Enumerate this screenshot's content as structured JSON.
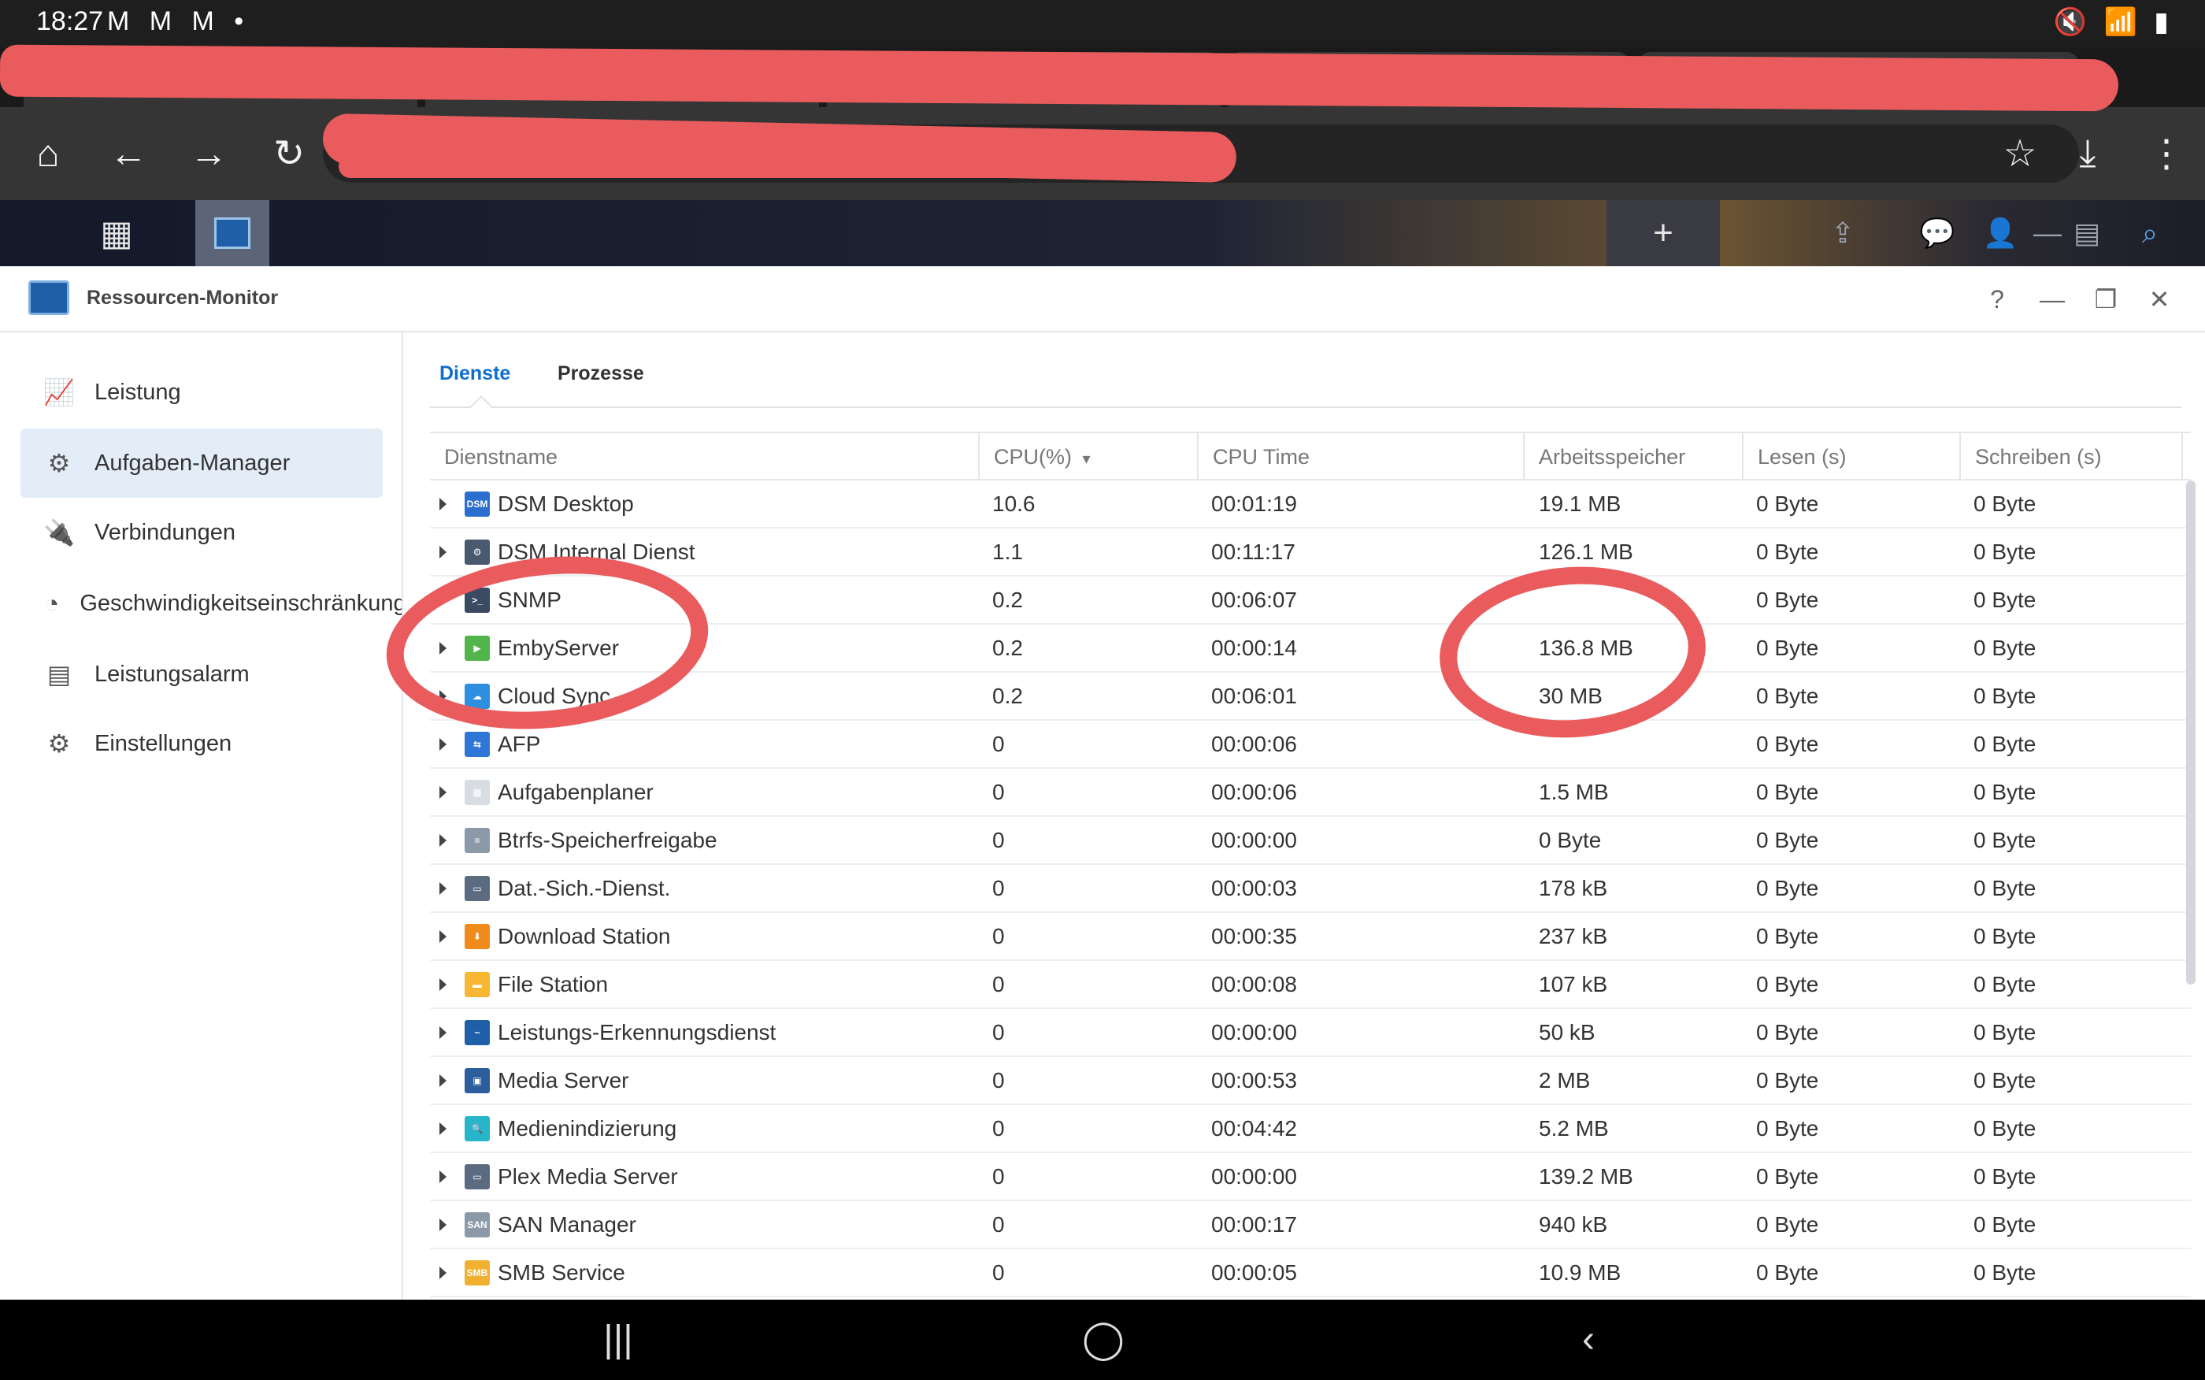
{
  "status_bar": {
    "time": "18:27",
    "notifications": "M M M •",
    "system_icons": "🔇 📶 ▮"
  },
  "browser": {
    "home_icon": "⌂",
    "back_icon": "←",
    "forward_icon": "→",
    "reload_icon": "↻",
    "star_icon": "☆",
    "download_icon": "⤓",
    "menu_icon": "⋮",
    "tab_close_icon": "×"
  },
  "dsm_taskbar": {
    "grid_icon": "▦",
    "add_icon": "+"
  },
  "window": {
    "title": "Ressourcen-Monitor",
    "controls": {
      "help": "?",
      "minimize": "—",
      "restore": "❐",
      "close": "✕"
    }
  },
  "sidebar": {
    "items": [
      {
        "label": "Leistung",
        "icon": "📈"
      },
      {
        "label": "Aufgaben-Manager",
        "icon": "⚙"
      },
      {
        "label": "Verbindungen",
        "icon": "🔌"
      },
      {
        "label": "Geschwindigkeitseinschränkung",
        "icon": "◔"
      },
      {
        "label": "Leistungsalarm",
        "icon": "▤"
      },
      {
        "label": "Einstellungen",
        "icon": "⚙"
      }
    ]
  },
  "tabs": [
    "Dienste",
    "Prozesse"
  ],
  "table": {
    "columns": [
      "Dienstname",
      "CPU(%)",
      "CPU Time",
      "Arbeitsspeicher",
      "Lesen (s)",
      "Schreiben (s)"
    ],
    "sort_indicator": "▾",
    "rows": [
      {
        "name": "DSM Desktop",
        "cpu": "10.6",
        "time": "00:01:19",
        "mem": "19.1 MB",
        "read": "0 Byte",
        "write": "0 Byte",
        "icon_bg": "#2a6fcf",
        "icon_text": "DSM"
      },
      {
        "name": "DSM Internal Dienst",
        "cpu": "1.1",
        "time": "00:11:17",
        "mem": "126.1 MB",
        "read": "0 Byte",
        "write": "0 Byte",
        "icon_bg": "#4a5a6e",
        "icon_text": "⚙"
      },
      {
        "name": "SNMP",
        "cpu": "0.2",
        "time": "00:06:07",
        "mem": "",
        "read": "0 Byte",
        "write": "0 Byte",
        "icon_bg": "#3a4a63",
        "icon_text": ">_"
      },
      {
        "name": "EmbyServer",
        "cpu": "0.2",
        "time": "00:00:14",
        "mem": "136.8 MB",
        "read": "0 Byte",
        "write": "0 Byte",
        "icon_bg": "#52b54b",
        "icon_text": "▶"
      },
      {
        "name": "Cloud Sync",
        "cpu": "0.2",
        "time": "00:06:01",
        "mem": "30 MB",
        "read": "0 Byte",
        "write": "0 Byte",
        "icon_bg": "#2e8fe0",
        "icon_text": "☁"
      },
      {
        "name": "AFP",
        "cpu": "0",
        "time": "00:00:06",
        "mem": "",
        "read": "0 Byte",
        "write": "0 Byte",
        "icon_bg": "#2f77d6",
        "icon_text": "⇆"
      },
      {
        "name": "Aufgabenplaner",
        "cpu": "0",
        "time": "00:00:06",
        "mem": "1.5 MB",
        "read": "0 Byte",
        "write": "0 Byte",
        "icon_bg": "#d8dde3",
        "icon_text": "▦"
      },
      {
        "name": "Btrfs-Speicherfreigabe",
        "cpu": "0",
        "time": "00:00:00",
        "mem": "0 Byte",
        "read": "0 Byte",
        "write": "0 Byte",
        "icon_bg": "#8c99a8",
        "icon_text": "≡"
      },
      {
        "name": "Dat.-Sich.-Dienst.",
        "cpu": "0",
        "time": "00:00:03",
        "mem": "178 kB",
        "read": "0 Byte",
        "write": "0 Byte",
        "icon_bg": "#5b6b80",
        "icon_text": "▭"
      },
      {
        "name": "Download Station",
        "cpu": "0",
        "time": "00:00:35",
        "mem": "237 kB",
        "read": "0 Byte",
        "write": "0 Byte",
        "icon_bg": "#f08a1c",
        "icon_text": "⬇"
      },
      {
        "name": "File Station",
        "cpu": "0",
        "time": "00:00:08",
        "mem": "107 kB",
        "read": "0 Byte",
        "write": "0 Byte",
        "icon_bg": "#f7b733",
        "icon_text": "▬"
      },
      {
        "name": "Leistungs-Erkennungsdienst",
        "cpu": "0",
        "time": "00:00:00",
        "mem": "50 kB",
        "read": "0 Byte",
        "write": "0 Byte",
        "icon_bg": "#1f5fa8",
        "icon_text": "~"
      },
      {
        "name": "Media Server",
        "cpu": "0",
        "time": "00:00:53",
        "mem": "2 MB",
        "read": "0 Byte",
        "write": "0 Byte",
        "icon_bg": "#2c5e9e",
        "icon_text": "▣"
      },
      {
        "name": "Medienindizierung",
        "cpu": "0",
        "time": "00:04:42",
        "mem": "5.2 MB",
        "read": "0 Byte",
        "write": "0 Byte",
        "icon_bg": "#27b6c9",
        "icon_text": "🔍"
      },
      {
        "name": "Plex Media Server",
        "cpu": "0",
        "time": "00:00:00",
        "mem": "139.2 MB",
        "read": "0 Byte",
        "write": "0 Byte",
        "icon_bg": "#5b6b80",
        "icon_text": "▭"
      },
      {
        "name": "SAN Manager",
        "cpu": "0",
        "time": "00:00:17",
        "mem": "940 kB",
        "read": "0 Byte",
        "write": "0 Byte",
        "icon_bg": "#8c99a8",
        "icon_text": "SAN"
      },
      {
        "name": "SMB Service",
        "cpu": "0",
        "time": "00:00:05",
        "mem": "10.9 MB",
        "read": "0 Byte",
        "write": "0 Byte",
        "icon_bg": "#f2b030",
        "icon_text": "SMB"
      }
    ]
  },
  "android_nav": {
    "recents": "|||",
    "home": "◯",
    "back": "‹"
  }
}
